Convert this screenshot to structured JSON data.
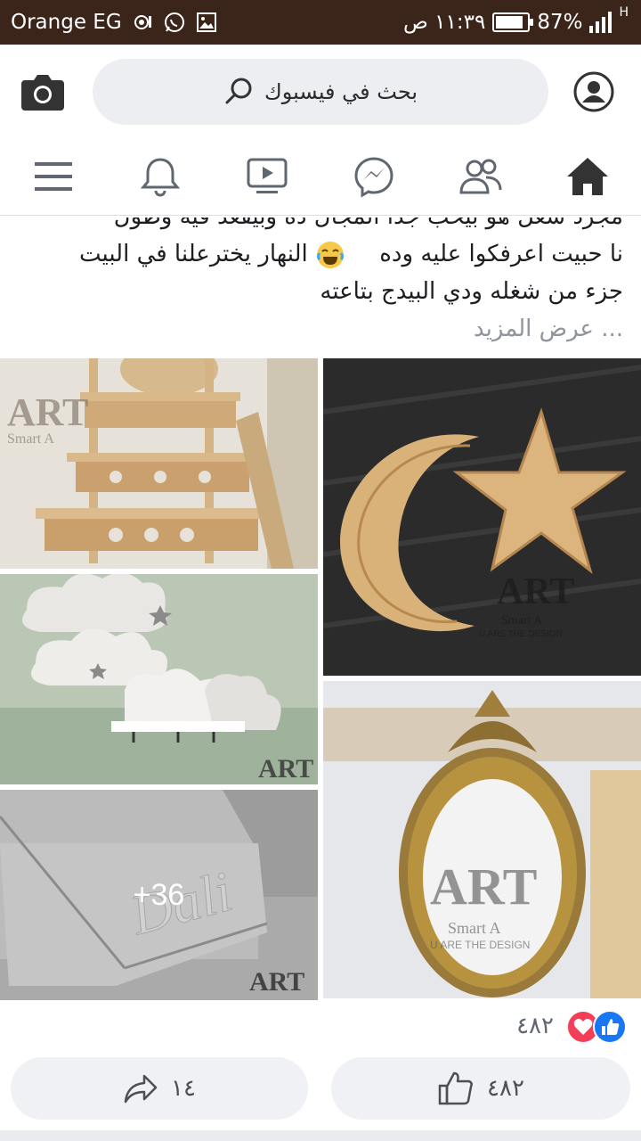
{
  "status_bar": {
    "carrier": "Orange EG",
    "battery_percent": "87%",
    "battery_level": 0.87,
    "time": "١١:٣٩ ص",
    "network": "H"
  },
  "header": {
    "search_placeholder": "بحث في فيسبوك",
    "icons": [
      "camera-icon",
      "search-icon",
      "profile-icon"
    ]
  },
  "nav": {
    "items": [
      "menu-icon",
      "bell-icon",
      "video-icon",
      "messenger-icon",
      "groups-icon",
      "home-icon"
    ],
    "active": "home-icon"
  },
  "post": {
    "lines": [
      "مجرد شغل هو بيحب جدا المجال ده وبيقعد فيه وطول",
      "النهار يخترعلنا في البيت",
      "نا حبيت اعرفكوا عليه وده",
      "جزء من شغله ودي البيدج بتاعته"
    ],
    "see_more": "... عرض المزيد",
    "more_photos": "+36",
    "watermark_text": "ART",
    "watermark_sub": "Smart A",
    "watermark_tag": "U ARE THE DESIGN"
  },
  "reactions": {
    "count": "٤٨٢",
    "types": [
      "like-icon",
      "love-icon"
    ]
  },
  "actions": {
    "share_count": "١٤",
    "like_count": "٤٨٢"
  },
  "colors": {
    "status_bar": "#3b2419",
    "facebook_blue": "#1877f2",
    "love_red": "#f33e58",
    "search_bg": "#eceef1"
  }
}
